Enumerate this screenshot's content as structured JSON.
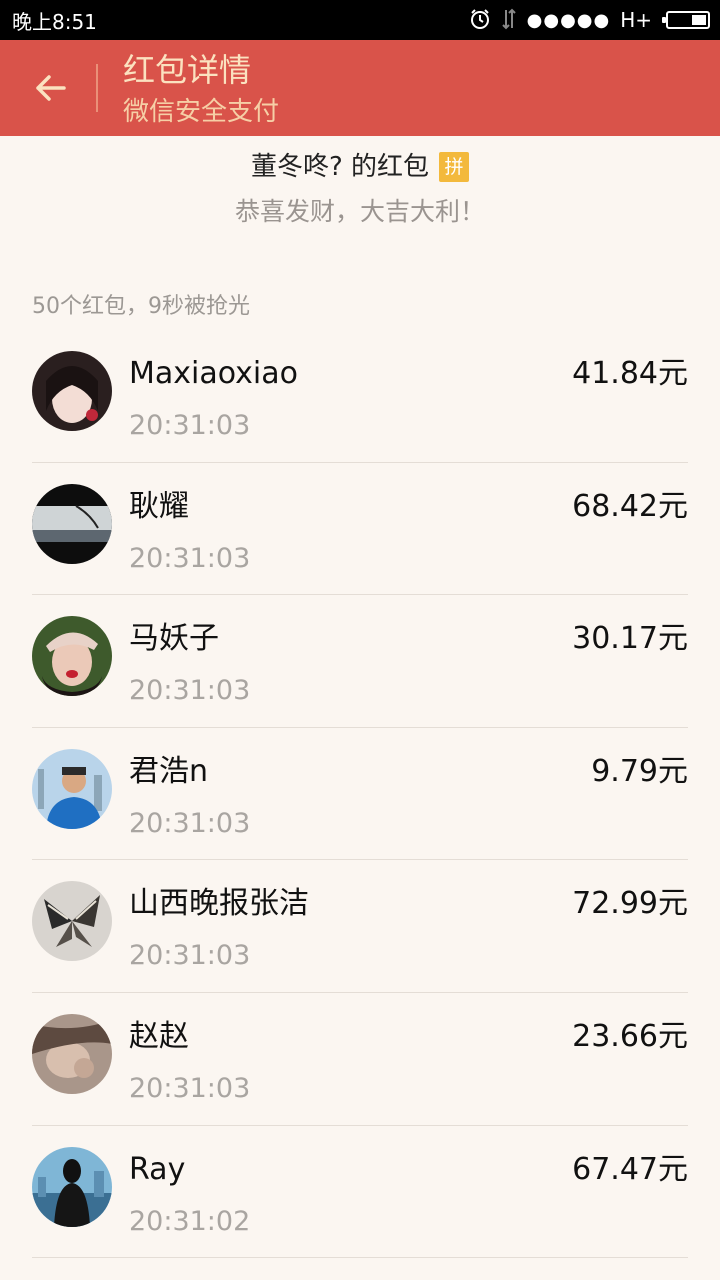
{
  "status_bar": {
    "time": "晚上8:51",
    "network": "H+",
    "icons": [
      "alarm-icon",
      "data-transfer-icon",
      "signal-icon",
      "battery-icon"
    ]
  },
  "header": {
    "title": "红包详情",
    "subtitle": "微信安全支付",
    "back_icon": "back-arrow-icon",
    "background_color": "#d9534a",
    "text_color": "#fbe2c0"
  },
  "sender": {
    "title": "董冬咚? 的红包",
    "badge": "拼",
    "wish": "恭喜发财，大吉大利！"
  },
  "summary": "50个红包，9秒被抢光",
  "recipients": [
    {
      "name": "Maxiaoxiao",
      "time": "20:31:03",
      "amount": "41.84元"
    },
    {
      "name": "耿耀",
      "time": "20:31:03",
      "amount": "68.42元"
    },
    {
      "name": "马妖子",
      "time": "20:31:03",
      "amount": "30.17元"
    },
    {
      "name": "君浩n",
      "time": "20:31:03",
      "amount": "9.79元"
    },
    {
      "name": "山西晚报张洁",
      "time": "20:31:03",
      "amount": "72.99元"
    },
    {
      "name": "赵赵",
      "time": "20:31:03",
      "amount": "23.66元"
    },
    {
      "name": "Ray",
      "time": "20:31:02",
      "amount": "67.47元"
    }
  ]
}
